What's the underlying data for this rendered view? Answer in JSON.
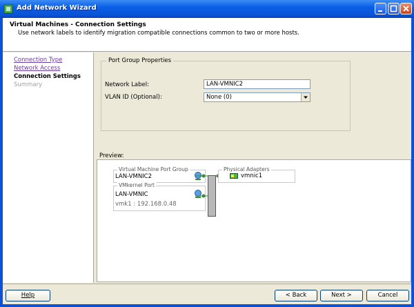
{
  "window": {
    "title": "Add Network Wizard"
  },
  "header": {
    "title": "Virtual Machines - Connection Settings",
    "subtitle": "Use network labels to identify migration compatible connections common to two or more hosts."
  },
  "nav": {
    "items": [
      {
        "label": "Connection Type",
        "state": "link"
      },
      {
        "label": "Network Access",
        "state": "link"
      },
      {
        "label": "Connection Settings",
        "state": "current"
      },
      {
        "label": "Summary",
        "state": "disabled"
      }
    ]
  },
  "port_group": {
    "legend": "Port Group Properties",
    "network_label_label": "Network Label:",
    "network_label_value": "LAN-VMNIC2",
    "vlan_label": "VLAN ID (Optional):",
    "vlan_value": "None (0)"
  },
  "preview": {
    "label": "Preview:",
    "vm_group_legend": "Virtual Machine Port Group",
    "vm_group_name": "LAN-VMNIC2",
    "vmkernel_legend": "VMkernel Port",
    "vmkernel_name": "LAN-VMNIC",
    "vmkernel_ip": "vmk1 : 192.168.0.48",
    "adapters_legend": "Physical Adapters",
    "adapter_name": "vmnic1"
  },
  "footer": {
    "help": "Help",
    "back_prefix": "< ",
    "back": "Back",
    "next": "Next",
    "next_suffix": " >",
    "cancel": "Cancel"
  },
  "colors": {
    "titlebar": "#0a5fe6",
    "link": "#6a3d9a",
    "port_dot": "#3a8a3a"
  },
  "icons": [
    "window-app-icon",
    "minimize-icon",
    "maximize-icon",
    "close-icon",
    "network-port-icon",
    "nic-icon",
    "dropdown-arrow-icon"
  ]
}
